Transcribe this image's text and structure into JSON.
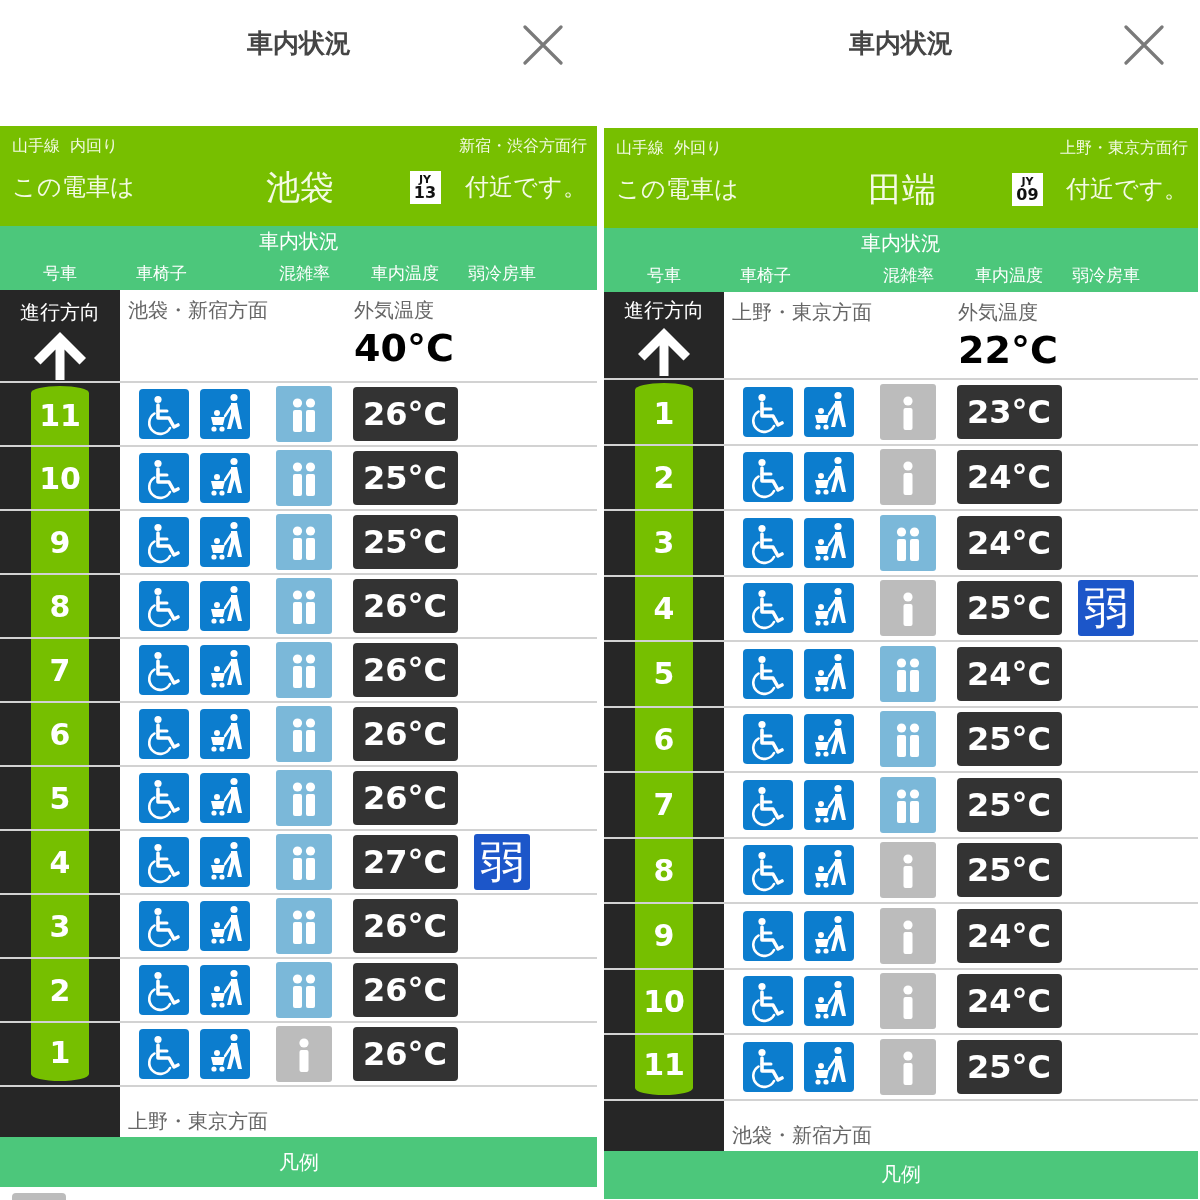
{
  "panels": [
    {
      "title": "車内状況",
      "line": "山手線  内回り",
      "bound_for": "新宿・渋谷方面行",
      "location_prefix": "この電車は",
      "station": "池袋",
      "station_code": {
        "line": "JY",
        "number": "13"
      },
      "location_suffix": "付近です。",
      "section_title": "車内状況",
      "columns": [
        "号車",
        "車椅子",
        "混雑率",
        "車内温度",
        "弱冷房車"
      ],
      "direction": {
        "label": "進行方向",
        "front": "池袋・新宿方面",
        "rear": "上野・東京方面"
      },
      "outside_temp": {
        "label": "外気温度",
        "value": "40°C"
      },
      "cars": [
        {
          "number": "11",
          "wheelchair": true,
          "stroller": true,
          "crowded": true,
          "temp": "26°C"
        },
        {
          "number": "10",
          "wheelchair": true,
          "stroller": true,
          "crowded": true,
          "temp": "25°C"
        },
        {
          "number": "9",
          "wheelchair": true,
          "stroller": true,
          "crowded": true,
          "temp": "25°C"
        },
        {
          "number": "8",
          "wheelchair": true,
          "stroller": true,
          "crowded": true,
          "temp": "26°C"
        },
        {
          "number": "7",
          "wheelchair": true,
          "stroller": true,
          "crowded": true,
          "temp": "26°C"
        },
        {
          "number": "6",
          "wheelchair": true,
          "stroller": true,
          "crowded": true,
          "temp": "26°C"
        },
        {
          "number": "5",
          "wheelchair": true,
          "stroller": true,
          "crowded": true,
          "temp": "26°C"
        },
        {
          "number": "4",
          "wheelchair": true,
          "stroller": true,
          "crowded": true,
          "temp": "27°C",
          "weak_ac": "弱"
        },
        {
          "number": "3",
          "wheelchair": true,
          "stroller": true,
          "crowded": true,
          "temp": "26°C"
        },
        {
          "number": "2",
          "wheelchair": true,
          "stroller": true,
          "crowded": true,
          "temp": "26°C"
        },
        {
          "number": "1",
          "wheelchair": true,
          "stroller": true,
          "crowded": false,
          "temp": "26°C"
        }
      ],
      "legend": {
        "title": "凡例",
        "entries": [
          {
            "crowded": false
          }
        ]
      }
    },
    {
      "title": "車内状況",
      "line": "山手線  外回り",
      "bound_for": "上野・東京方面行",
      "location_prefix": "この電車は",
      "station": "田端",
      "station_code": {
        "line": "JY",
        "number": "09"
      },
      "location_suffix": "付近です。",
      "section_title": "車内状況",
      "columns": [
        "号車",
        "車椅子",
        "混雑率",
        "車内温度",
        "弱冷房車"
      ],
      "direction": {
        "label": "進行方向",
        "front": "上野・東京方面",
        "rear": "池袋・新宿方面"
      },
      "outside_temp": {
        "label": "外気温度",
        "value": "22°C"
      },
      "cars": [
        {
          "number": "1",
          "wheelchair": true,
          "stroller": true,
          "crowded": false,
          "temp": "23°C"
        },
        {
          "number": "2",
          "wheelchair": true,
          "stroller": true,
          "crowded": false,
          "temp": "24°C"
        },
        {
          "number": "3",
          "wheelchair": true,
          "stroller": true,
          "crowded": true,
          "temp": "24°C"
        },
        {
          "number": "4",
          "wheelchair": true,
          "stroller": true,
          "crowded": false,
          "temp": "25°C",
          "weak_ac": "弱"
        },
        {
          "number": "5",
          "wheelchair": true,
          "stroller": true,
          "crowded": true,
          "temp": "24°C"
        },
        {
          "number": "6",
          "wheelchair": true,
          "stroller": true,
          "crowded": true,
          "temp": "25°C"
        },
        {
          "number": "7",
          "wheelchair": true,
          "stroller": true,
          "crowded": true,
          "temp": "25°C"
        },
        {
          "number": "8",
          "wheelchair": true,
          "stroller": true,
          "crowded": false,
          "temp": "25°C"
        },
        {
          "number": "9",
          "wheelchair": true,
          "stroller": true,
          "crowded": false,
          "temp": "24°C"
        },
        {
          "number": "10",
          "wheelchair": true,
          "stroller": true,
          "crowded": false,
          "temp": "24°C"
        },
        {
          "number": "11",
          "wheelchair": true,
          "stroller": true,
          "crowded": false,
          "temp": "25°C"
        }
      ],
      "legend": {
        "title": "凡例"
      }
    }
  ]
}
